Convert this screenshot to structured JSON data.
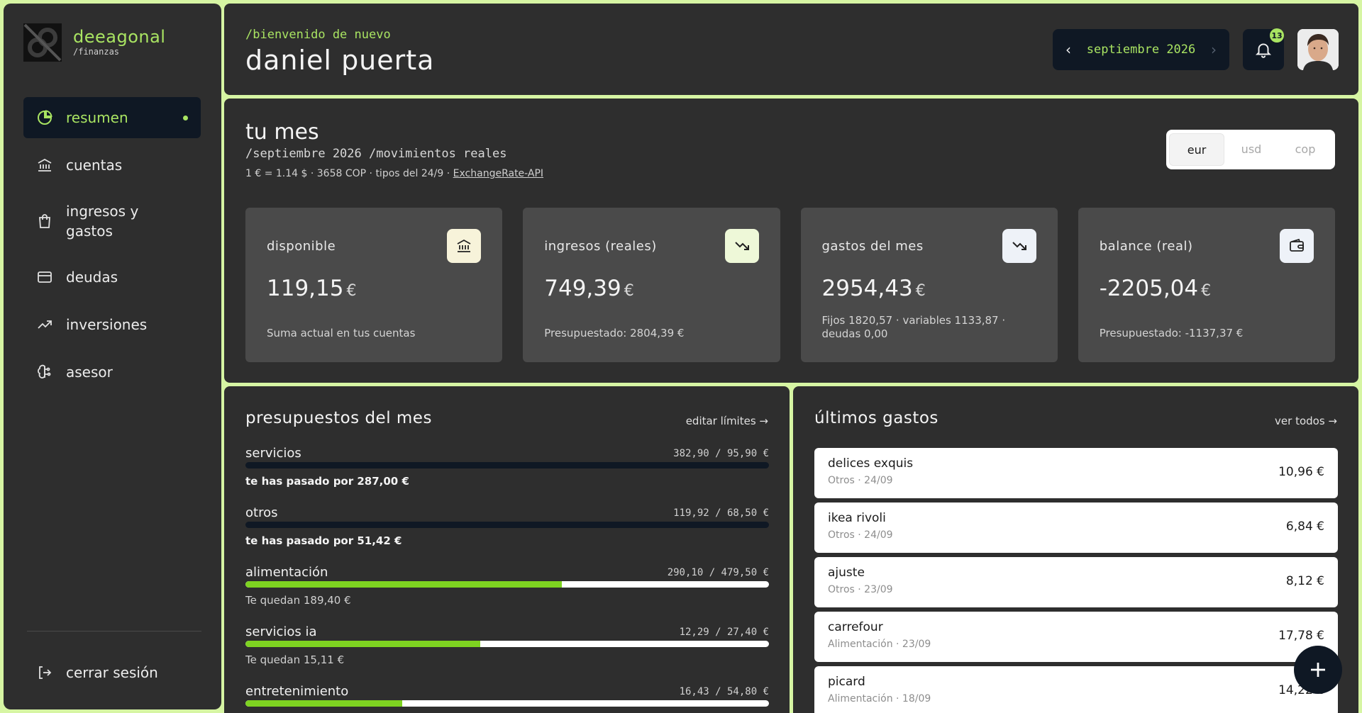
{
  "brand": {
    "name": "deeagonal",
    "sub": "/finanzas"
  },
  "nav": {
    "items": [
      {
        "label": "resumen",
        "icon": "pie-chart-icon",
        "active": true
      },
      {
        "label": "cuentas",
        "icon": "bank-icon"
      },
      {
        "label": "ingresos y gastos",
        "icon": "shopping-bag-icon"
      },
      {
        "label": "deudas",
        "icon": "credit-card-icon"
      },
      {
        "label": "inversiones",
        "icon": "trending-up-icon"
      },
      {
        "label": "asesor",
        "icon": "brain-icon"
      }
    ],
    "logout": "cerrar sesión"
  },
  "header": {
    "welcome": "/bienvenido de nuevo",
    "user": "daniel puerta",
    "month": "septiembre 2026",
    "notifications": "13"
  },
  "month": {
    "title": "tu mes",
    "subtitle": "/septiembre 2026 /movimientos reales",
    "rate_text": "1 € = 1.14 $ · 3658 COP · tipos del 24/9 · ",
    "rate_link": "ExchangeRate-API",
    "currencies": [
      "eur",
      "usd",
      "cop"
    ],
    "selected_currency": "eur",
    "stats": [
      {
        "label": "disponible",
        "value": "119,15",
        "currency": "€",
        "note": "Suma actual en tus cuentas",
        "icon": "bank-icon",
        "icon_bg": "#f7f3da"
      },
      {
        "label": "ingresos (reales)",
        "value": "749,39",
        "currency": "€",
        "note": "Presupuestado: 2804,39 €",
        "icon": "trending-down-icon",
        "icon_bg": "#eef8d8"
      },
      {
        "label": "gastos del mes",
        "value": "2954,43",
        "currency": "€",
        "note": "Fijos 1820,57 · variables 1133,87 · deudas 0,00",
        "icon": "trending-down-icon",
        "icon_bg": "#eef2f8"
      },
      {
        "label": "balance (real)",
        "value": "-2205,04",
        "currency": "€",
        "note": "Presupuestado: -1137,37 €",
        "icon": "wallet-icon",
        "icon_bg": "#eef2f8"
      }
    ]
  },
  "budgets": {
    "title": "presupuestos del mes",
    "edit": "editar límites →",
    "items": [
      {
        "name": "servicios",
        "amount": "382,90 / 95,90 €",
        "fill": 1.0,
        "over": true,
        "message": "te has pasado por 287,00 €"
      },
      {
        "name": "otros",
        "amount": "119,92 / 68,50 €",
        "fill": 1.0,
        "over": true,
        "message": "te has pasado por 51,42 €"
      },
      {
        "name": "alimentación",
        "amount": "290,10 / 479,50 €",
        "fill": 0.605,
        "over": false,
        "message": "Te quedan 189,40 €"
      },
      {
        "name": "servicios ia",
        "amount": "12,29 / 27,40 €",
        "fill": 0.449,
        "over": false,
        "message": "Te quedan 15,11 €"
      },
      {
        "name": "entretenimiento",
        "amount": "16,43 / 54,80 €",
        "fill": 0.3,
        "over": false,
        "message": ""
      }
    ]
  },
  "expenses": {
    "title": "últimos gastos",
    "see_all": "ver todos →",
    "items": [
      {
        "name": "delices exquis",
        "meta": "Otros · 24/09",
        "amount": "10,96 €"
      },
      {
        "name": "ikea rivoli",
        "meta": "Otros · 24/09",
        "amount": "6,84 €"
      },
      {
        "name": "ajuste",
        "meta": "Otros · 23/09",
        "amount": "8,12 €"
      },
      {
        "name": "carrefour",
        "meta": "Alimentación · 23/09",
        "amount": "17,78 €"
      },
      {
        "name": "picard",
        "meta": "Alimentación · 18/09",
        "amount": "14,22 €"
      }
    ]
  },
  "colors": {
    "accent": "#a9e462",
    "dark": "#0f1824",
    "panel": "#2e2e2e",
    "tile": "#4a4a4a",
    "progress": "#7ed321"
  }
}
